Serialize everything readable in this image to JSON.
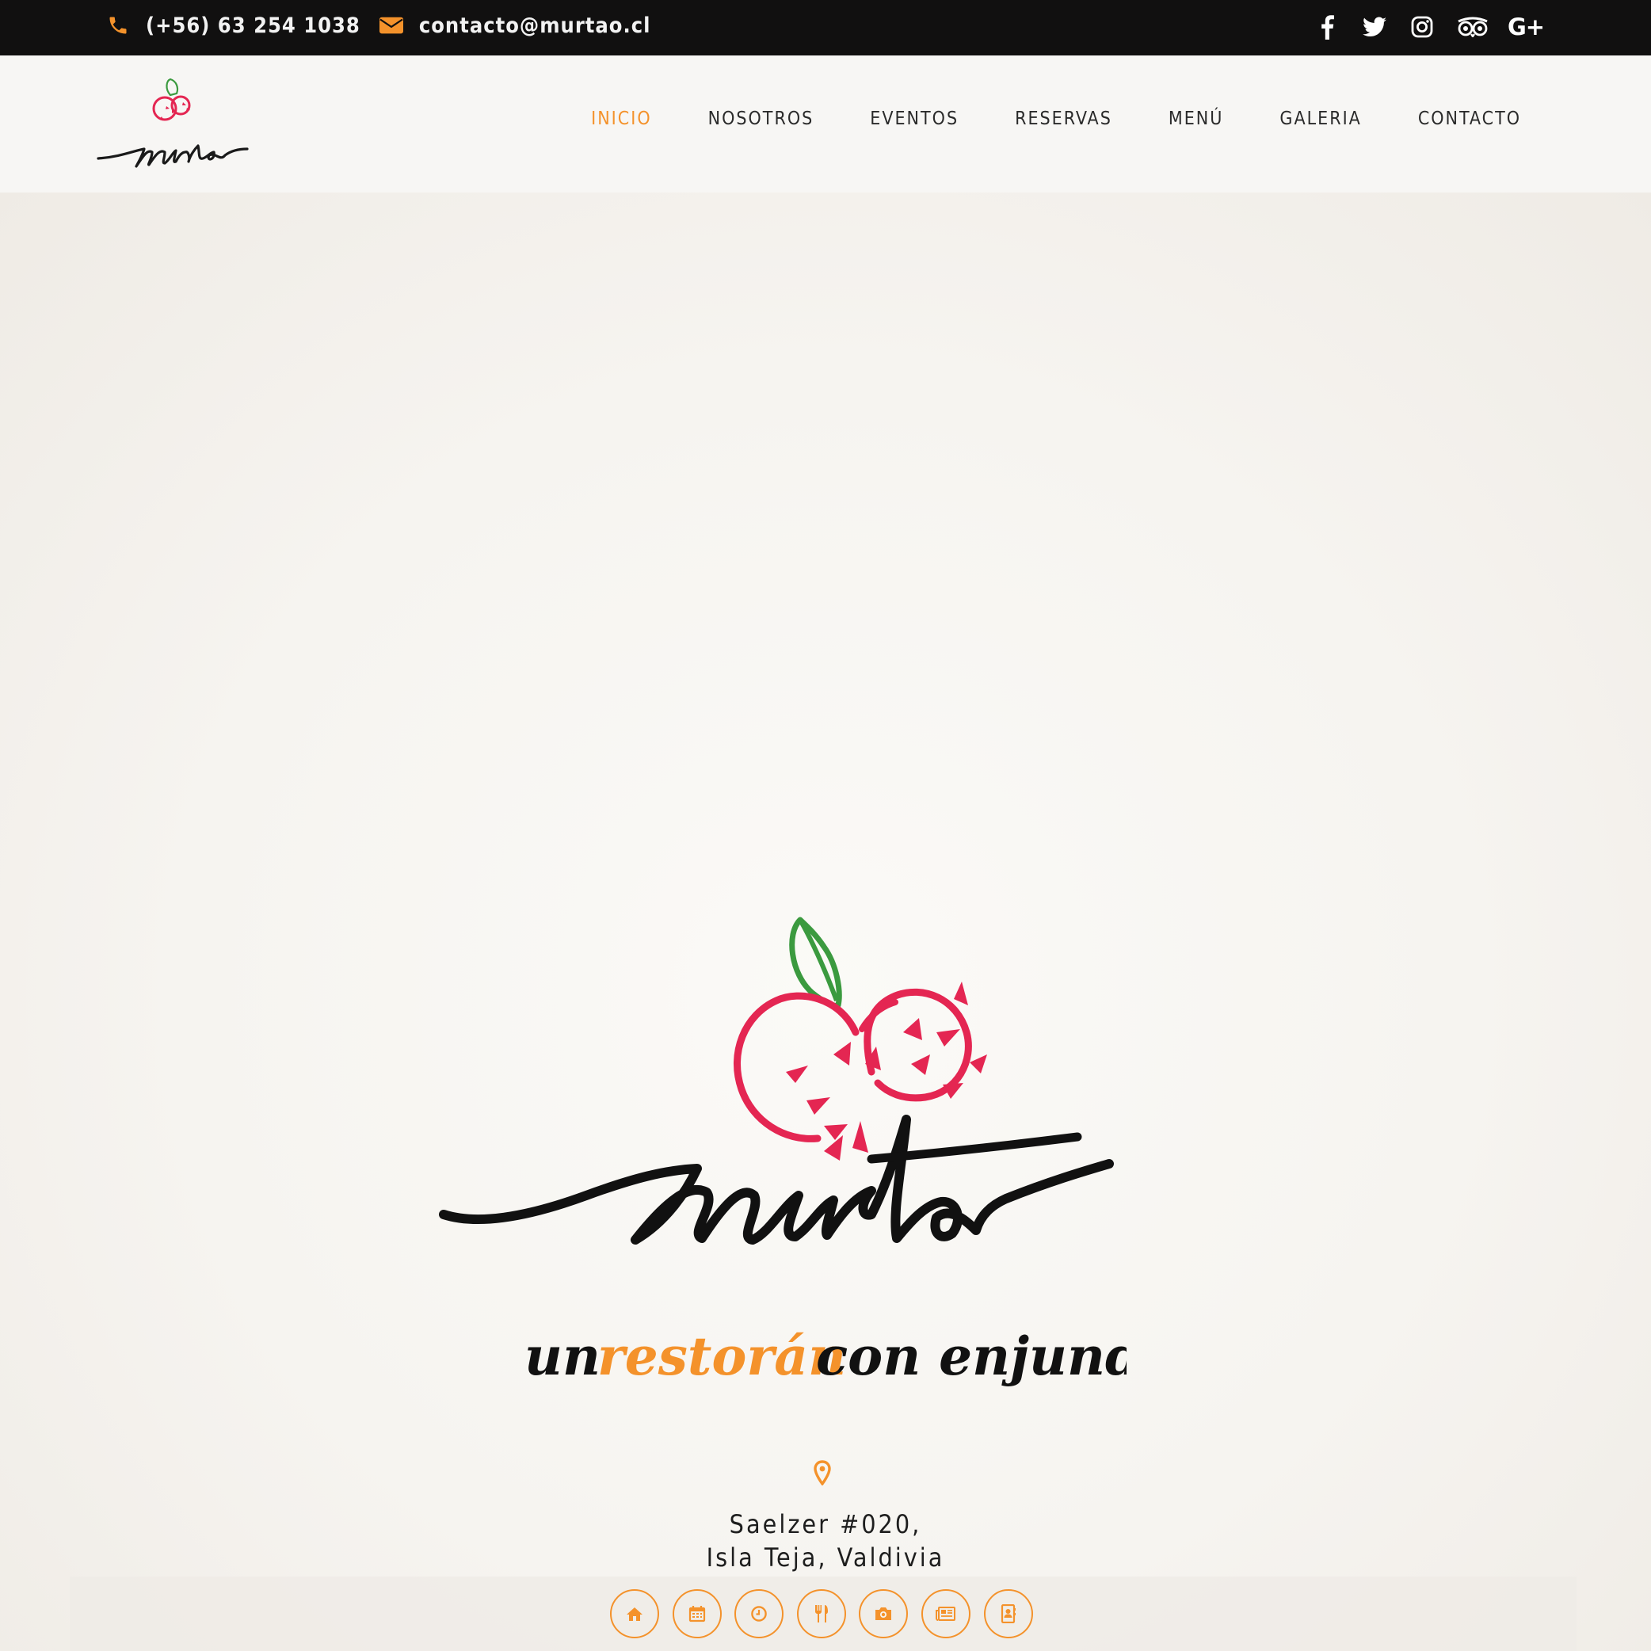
{
  "topbar": {
    "phone": "(+56) 63 254 1038",
    "email": "contacto@murtao.cl",
    "social": [
      {
        "icon": "facebook-icon"
      },
      {
        "icon": "twitter-icon"
      },
      {
        "icon": "instagram-icon"
      },
      {
        "icon": "tripadvisor-icon"
      },
      {
        "icon": "google-plus-icon",
        "label": "G+"
      }
    ]
  },
  "brand": {
    "logo_wordmark": "murtao",
    "tagline_parts": [
      "un",
      "restorán",
      "con enjundia"
    ]
  },
  "nav": {
    "items": [
      {
        "label": "INICIO",
        "active": true
      },
      {
        "label": "NOSOTROS",
        "active": false
      },
      {
        "label": "EVENTOS",
        "active": false
      },
      {
        "label": "RESERVAS",
        "active": false
      },
      {
        "label": "MENÚ",
        "active": false
      },
      {
        "label": "GALERIA",
        "active": false
      },
      {
        "label": "CONTACTO",
        "active": false
      }
    ]
  },
  "hero": {
    "address_line1": "Saelzer #020,",
    "address_line2": "Isla Teja, Valdivia"
  },
  "quicklinks": [
    {
      "icon": "home-icon"
    },
    {
      "icon": "calendar-icon"
    },
    {
      "icon": "clock-icon"
    },
    {
      "icon": "utensils-icon"
    },
    {
      "icon": "camera-icon"
    },
    {
      "icon": "newspaper-icon"
    },
    {
      "icon": "contact-book-icon"
    }
  ],
  "colors": {
    "accent": "#f4922b",
    "topbar_bg": "#111010",
    "berry": "#e42652",
    "leaf": "#3b9a3f",
    "ink": "#121212"
  }
}
